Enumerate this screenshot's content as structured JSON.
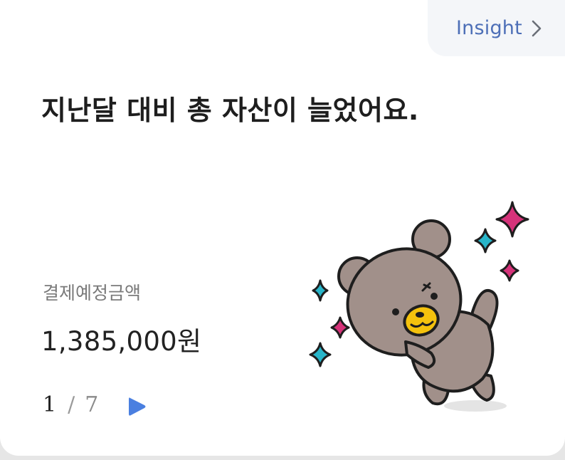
{
  "insight": {
    "label": "Insight"
  },
  "headline": "지난달 대비 총 자산이 늘었어요.",
  "payment": {
    "label": "결제예정금액",
    "amount": "1,385,000원"
  },
  "pager": {
    "current": "1",
    "separator": "/",
    "total": "7"
  },
  "colors": {
    "accent": "#4d6fb7",
    "play": "#4a7fe0",
    "bear_fur": "#a1908a",
    "sparkle_pink": "#d6337a",
    "sparkle_teal": "#28b5c9"
  },
  "illustration": {
    "icon": "bear-sticker-icon"
  }
}
